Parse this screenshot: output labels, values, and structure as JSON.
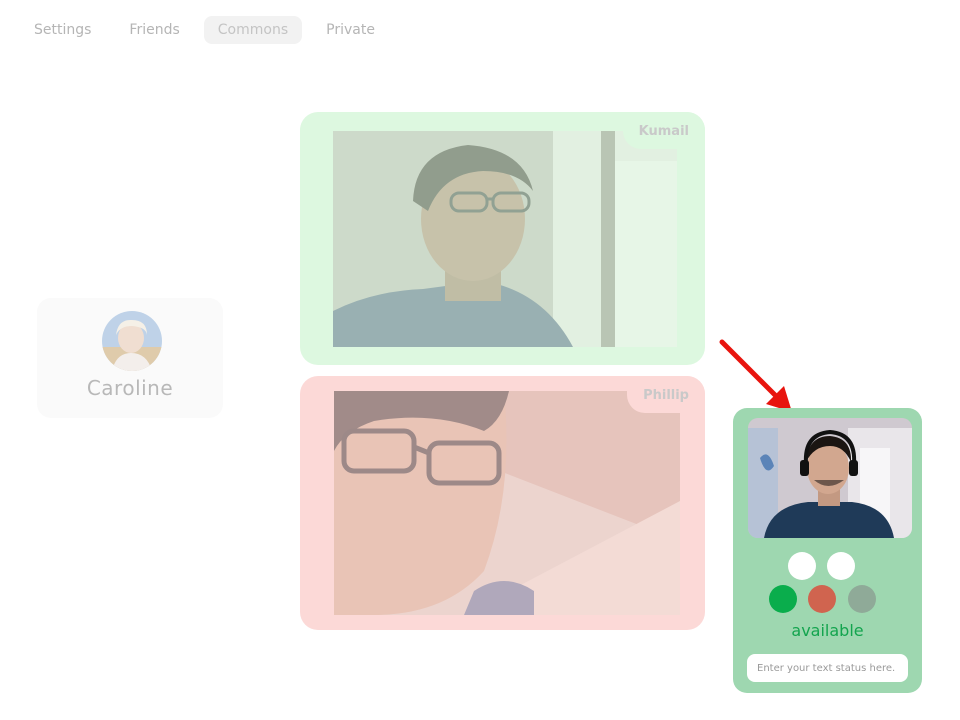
{
  "nav": {
    "tabs": [
      {
        "label": "Settings",
        "active": false
      },
      {
        "label": "Friends",
        "active": false
      },
      {
        "label": "Commons",
        "active": true
      },
      {
        "label": "Private",
        "active": false
      }
    ]
  },
  "contact": {
    "name": "Caroline"
  },
  "calls": [
    {
      "name": "Kumail",
      "state_color": "#ddf8e0"
    },
    {
      "name": "Phillip",
      "state_color": "#fcd9d7"
    }
  ],
  "self": {
    "status_label": "available",
    "status_color": "#13a44e",
    "status_input": {
      "placeholder": "Enter your text status here.",
      "value": ""
    },
    "status_options": [
      {
        "name": "available",
        "color": "#0aad4c"
      },
      {
        "name": "busy",
        "color": "#d0644f"
      },
      {
        "name": "away",
        "color": "#8faa98"
      }
    ],
    "extra_toggles": [
      "toggle-1",
      "toggle-2"
    ]
  },
  "colors": {
    "arrow": "#e8140e",
    "self_panel_bg": "#9ed7b0"
  }
}
